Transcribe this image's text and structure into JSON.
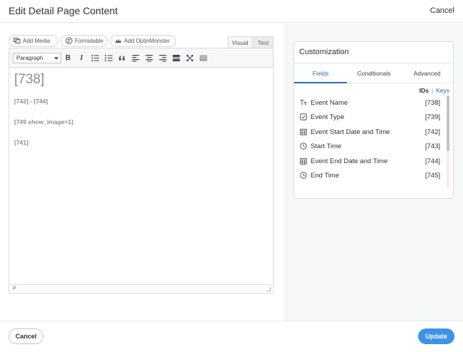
{
  "header": {
    "title": "Edit Detail Page Content",
    "cancel_label": "Cancel"
  },
  "media_buttons": [
    {
      "label": "Add Media",
      "icon": "add-media-icon"
    },
    {
      "label": "Formidable",
      "icon": "formidable-icon"
    },
    {
      "label": "Add OptinMonster",
      "icon": "optinmonster-icon"
    }
  ],
  "editor_tabs": {
    "visual": "Visual",
    "text": "Text"
  },
  "toolbar": {
    "format_value": "Paragraph",
    "bold": "B",
    "italic": "I",
    "buttons": [
      "bold",
      "italic",
      "bullet-list",
      "numbered-list",
      "blockquote",
      "align-left",
      "align-center",
      "align-right",
      "insert-more",
      "fullscreen",
      "toolbar-toggle"
    ]
  },
  "content": {
    "line1": "[738]",
    "line2": "[742] - [744]",
    "line3": "[749 show_image=1]",
    "line4": "[741]"
  },
  "statusbar": {
    "path": "P"
  },
  "panel": {
    "title": "Customization",
    "tabs": [
      "Fields",
      "Conditionals",
      "Advanced"
    ],
    "ids_label": "IDs",
    "separator": "|",
    "keys_label": "Keys",
    "fields": [
      {
        "name": "Event Name",
        "id": "[738]",
        "icon": "text-icon"
      },
      {
        "name": "Event Type",
        "id": "[739]",
        "icon": "checkbox-icon"
      },
      {
        "name": "Event Start Date and Time",
        "id": "[742]",
        "icon": "calendar-icon"
      },
      {
        "name": "Start Time",
        "id": "[743]",
        "icon": "clock-icon"
      },
      {
        "name": "Event End Date and Time",
        "id": "[744]",
        "icon": "calendar-icon"
      },
      {
        "name": "End Time",
        "id": "[745]",
        "icon": "clock-icon"
      }
    ]
  },
  "footer": {
    "cancel_label": "Cancel",
    "update_label": "Update"
  },
  "colors": {
    "accent": "#2271b1",
    "update_button": "#3c94e8"
  }
}
